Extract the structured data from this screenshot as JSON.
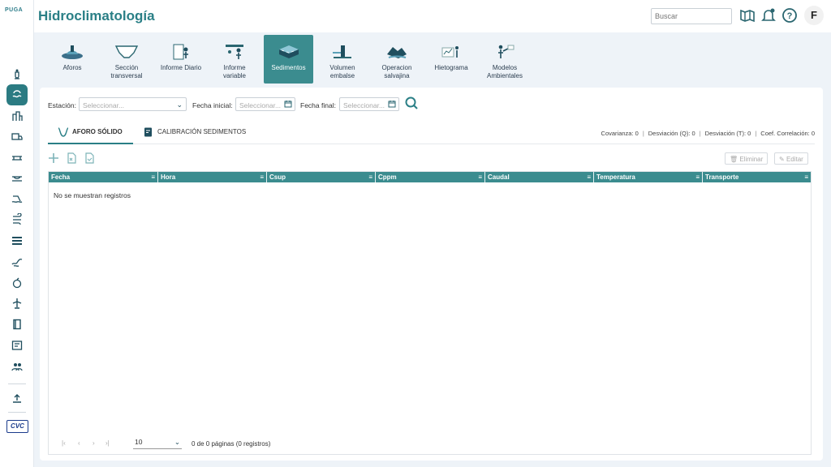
{
  "app": {
    "logo": "PUGA",
    "title": "Hidroclimatología"
  },
  "header": {
    "search_placeholder": "Buscar",
    "avatar_letter": "F"
  },
  "modules": [
    {
      "label": "Aforos",
      "icon": "flow-gauge-icon"
    },
    {
      "label": "Sección transversal",
      "icon": "cross-section-icon"
    },
    {
      "label": "Informe Diario",
      "icon": "daily-report-icon"
    },
    {
      "label": "Informe variable",
      "icon": "variable-report-icon"
    },
    {
      "label": "Sedimentos",
      "icon": "sediments-icon",
      "active": true
    },
    {
      "label": "Volumen embalse",
      "icon": "reservoir-volume-icon"
    },
    {
      "label": "Operacion salvajina",
      "icon": "salvajina-operation-icon"
    },
    {
      "label": "Hietograma",
      "icon": "hyetograph-icon"
    },
    {
      "label": "Modelos Ambientales",
      "icon": "environmental-models-icon"
    }
  ],
  "filters": {
    "station_label": "Estación:",
    "station_placeholder": "Seleccionar...",
    "start_label": "Fecha inicial:",
    "start_placeholder": "Seleccionar...",
    "end_label": "Fecha final:",
    "end_placeholder": "Seleccionar..."
  },
  "tabs": [
    {
      "label": "AFORO SÓLIDO",
      "active": true
    },
    {
      "label": "CALIBRACIÓN SEDIMENTOS",
      "active": false
    }
  ],
  "stats": {
    "covarianza": "Covarianza: 0",
    "desviacion_q": "Desviación (Q): 0",
    "desviacion_t": "Desviación (T): 0",
    "correlacion": "Coef. Correlación: 0"
  },
  "actions": {
    "delete_label": "Eliminar",
    "edit_label": "Editar"
  },
  "grid": {
    "columns": [
      "Fecha",
      "Hora",
      "Csup",
      "Cppm",
      "Caudal",
      "Temperatura",
      "Transporte"
    ],
    "empty_message": "No se muestran registros"
  },
  "pager": {
    "page_size": "10",
    "info": "0 de 0 páginas (0 registros)"
  },
  "sidebar_logo": "CVC",
  "colors": {
    "accent": "#3b8c8f",
    "title": "#2a7f86"
  }
}
